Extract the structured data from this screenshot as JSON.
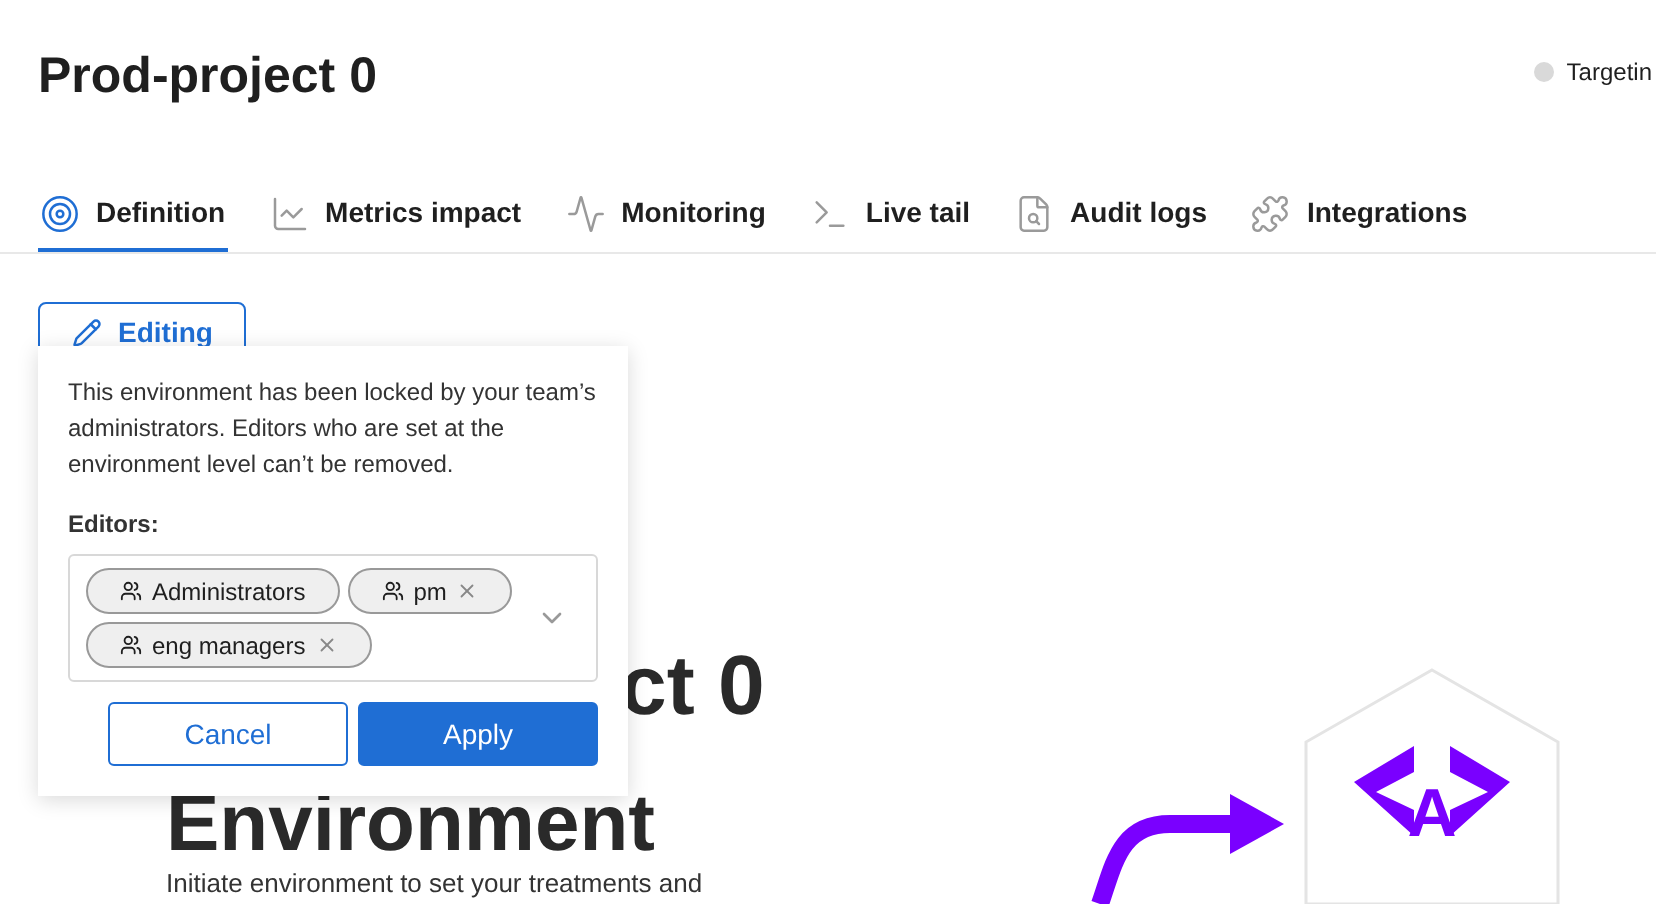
{
  "page": {
    "title": "Prod-project 0",
    "status": {
      "label": "Targetin",
      "color": "#d9d9d9"
    }
  },
  "tabs": [
    {
      "label": "Definition",
      "kind": "target",
      "selected": true
    },
    {
      "label": "Metrics impact",
      "kind": "chart",
      "selected": false
    },
    {
      "label": "Monitoring",
      "kind": "pulse",
      "selected": false
    },
    {
      "label": "Live tail",
      "kind": "terminal",
      "selected": false
    },
    {
      "label": "Audit logs",
      "kind": "log",
      "selected": false
    },
    {
      "label": "Integrations",
      "kind": "puzzle",
      "selected": false
    }
  ],
  "edit_button": {
    "label": "Editing"
  },
  "popover": {
    "message": "This environment has been locked by your team’s administrators. Editors who are set at the environment level can’t be removed.",
    "editors_label": "Editors:",
    "editors": [
      {
        "label": "Administrators",
        "removable": false
      },
      {
        "label": "pm",
        "removable": true
      },
      {
        "label": "eng managers",
        "removable": true
      }
    ],
    "buttons": [
      {
        "label": "Cancel",
        "kind": "secondary"
      },
      {
        "label": "Apply",
        "kind": "primary"
      }
    ]
  },
  "logo": {
    "letter": "A"
  },
  "background": {
    "heading_lines": [
      "ct 0",
      "Environment"
    ],
    "description": "Initiate environment to set your treatments and"
  }
}
